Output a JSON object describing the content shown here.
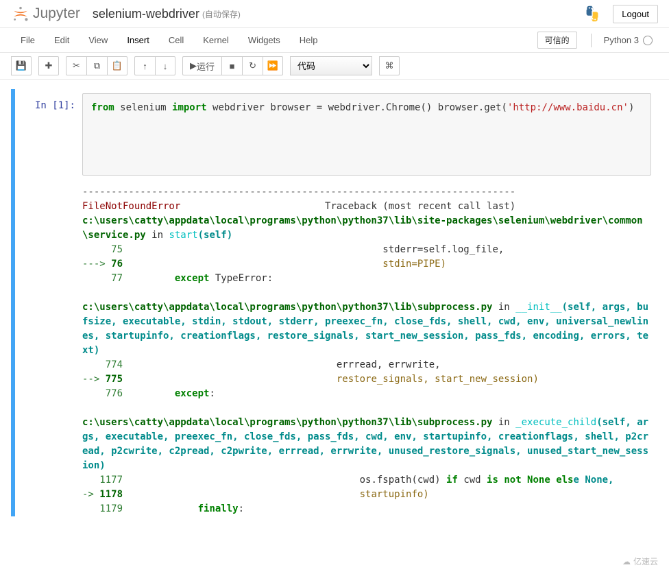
{
  "header": {
    "logo_text": "Jupyter",
    "title": "selenium-webdriver",
    "autosave": "(自动保存)",
    "logout": "Logout"
  },
  "menubar": {
    "items": [
      "File",
      "Edit",
      "View",
      "Insert",
      "Cell",
      "Kernel",
      "Widgets",
      "Help"
    ],
    "trusted": "可信的",
    "kernel": "Python 3"
  },
  "toolbar": {
    "run_label": "运行",
    "cell_type": "代码"
  },
  "cell": {
    "prompt_label": "In  [1]:",
    "code": {
      "l1_kw1": "from",
      "l1_mod": " selenium ",
      "l1_kw2": "import",
      "l1_name": " webdriver",
      "l3": "browser = webdriver.Chrome()",
      "l4a": "browser.get(",
      "l4s": "'http://www.baidu.cn'",
      "l4b": ")"
    }
  },
  "traceback": {
    "sep": "---------------------------------------------------------------------------",
    "err_name": "FileNotFoundError",
    "err_hdr": "                         Traceback (most recent call last)",
    "f1_path": "c:\\users\\catty\\appdata\\local\\programs\\python\\python37\\lib\\site-packages\\selenium\\webdriver\\common\\service.py",
    "f1_in": " in ",
    "f1_fn": "start",
    "f1_args": "(self)",
    "f1_l75_n": "     75",
    "f1_l75_c": "                                             stderr=self.log_file,",
    "f1_arrow": "---> ",
    "f1_l76_n": "76",
    "f1_l76_c": "                                             stdin=PIPE)",
    "f1_l77_n": "     77",
    "f1_l77_kw": "         except",
    "f1_l77_c": " TypeError:",
    "f2_path": "c:\\users\\catty\\appdata\\local\\programs\\python\\python37\\lib\\subprocess.py",
    "f2_in": " in ",
    "f2_fn": "__init__",
    "f2_args": "(self, args, bufsize, executable, stdin, stdout, stderr, preexec_fn, close_fds, shell, cwd, env, universal_newlines, startupinfo, creationflags, restore_signals, start_new_session, pass_fds, encoding, errors, text)",
    "f2_l774_n": "    774",
    "f2_l774_c": "                                     errread, errwrite,",
    "f2_arrow": "--> ",
    "f2_l775_n": "775",
    "f2_l775_c": "                                     restore_signals, start_new_session)",
    "f2_l776_n": "    776",
    "f2_l776_kw": "         except",
    "f3_path": "c:\\users\\catty\\appdata\\local\\programs\\python\\python37\\lib\\subprocess.py",
    "f3_in": " in ",
    "f3_fn": "_execute_child",
    "f3_args": "(self, args, executable, preexec_fn, close_fds, pass_fds, cwd, env, startupinfo, creationflags, shell, p2cread, p2cwrite, c2pread, c2pwrite, errread, errwrite, unused_restore_signals, unused_start_new_session)",
    "f3_l1177_n": "   1177",
    "f3_l1177_c": "                                         os.fspath(cwd) ",
    "f3_l1177_kw1": "if",
    "f3_l1177_c2": " cwd ",
    "f3_l1177_kw2": "is not None els",
    "f3_l1177_end": "e None,",
    "f3_arrow": "-> ",
    "f3_l1178_n": "1178",
    "f3_l1178_c": "                                         startupinfo)",
    "f3_l1179_n": "   1179",
    "f3_l1179_kw": "             finally",
    "colon": ":"
  },
  "watermark": "亿速云"
}
